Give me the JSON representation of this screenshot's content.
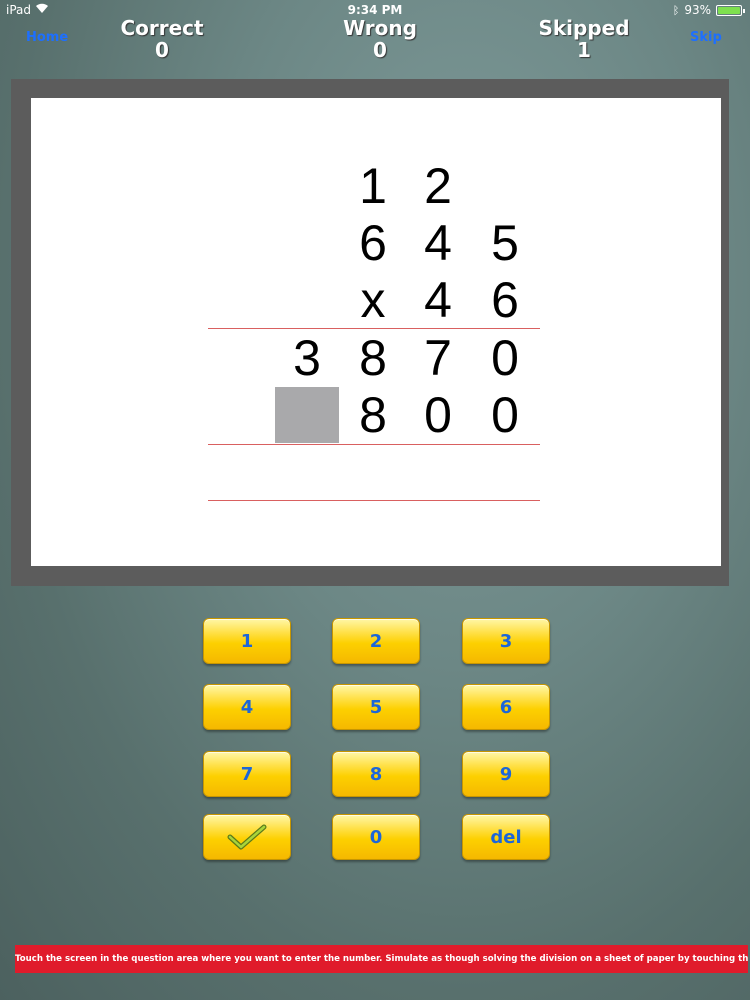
{
  "status_bar": {
    "device": "iPad",
    "time": "9:34 PM",
    "battery": "93%"
  },
  "nav": {
    "home_label": "Home",
    "skip_label": "Skip"
  },
  "scores": {
    "correct": {
      "label": "Correct",
      "value": "0"
    },
    "wrong": {
      "label": "Wrong",
      "value": "0"
    },
    "skipped": {
      "label": "Skipped",
      "value": "1"
    }
  },
  "problem": {
    "carry_row": [
      "1",
      "2"
    ],
    "multiplicand": [
      "6",
      "4",
      "5"
    ],
    "multiplier": [
      "x",
      "4",
      "6"
    ],
    "partial_1": [
      "3",
      "8",
      "7",
      "0"
    ],
    "partial_2": [
      "8",
      "0",
      "0"
    ]
  },
  "keypad": {
    "k1": "1",
    "k2": "2",
    "k3": "3",
    "k4": "4",
    "k5": "5",
    "k6": "6",
    "k7": "7",
    "k8": "8",
    "k9": "9",
    "k0": "0",
    "del": "del"
  },
  "hint": "Touch the screen in the question area where you want to enter the number. Simulate as though solving the division on a sheet of paper by touching the screen.",
  "colors": {
    "accent": "#1d6fff",
    "key_text": "#1c66d9",
    "hint_bg": "#e01b2b"
  }
}
